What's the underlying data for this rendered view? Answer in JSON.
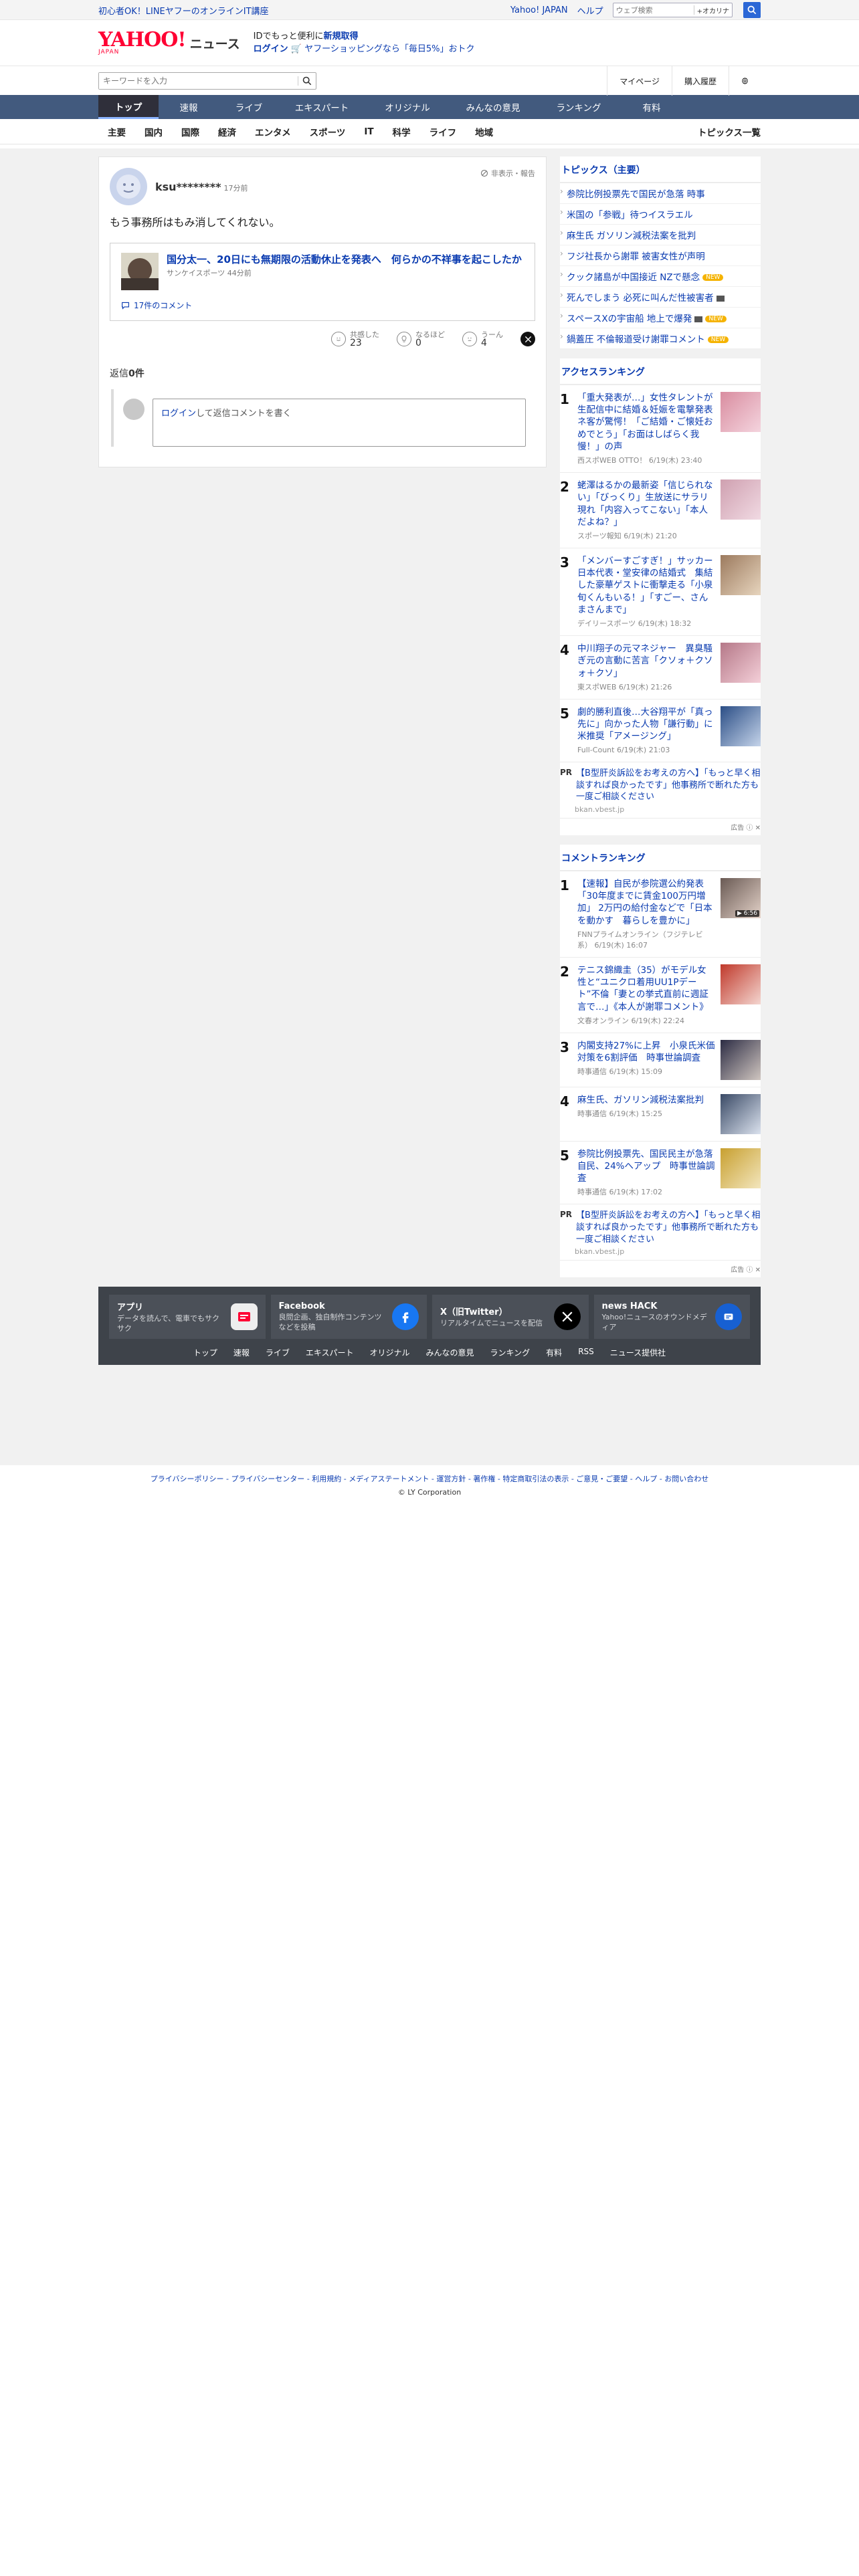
{
  "promo": {
    "text": "初心者OK！LINEヤフーのオンラインIT講座",
    "yahoo_japan": "Yahoo! JAPAN",
    "help": "ヘルプ",
    "web_search_placeholder": "ウェブ検索",
    "kakaku": "+オカリナ"
  },
  "header": {
    "logo_main": "YAHOO!",
    "logo_sub": "JAPAN",
    "logo_news": "ニュース",
    "msg_prefix": "IDでもっと便利に",
    "msg_signup": "新規取得",
    "login": "ログイン",
    "shopping_msg": "ヤフーショッピングなら「毎日5%」おトク"
  },
  "search": {
    "placeholder": "キーワードを入力",
    "mypage": "マイページ",
    "history": "購入履歴"
  },
  "navtabs": [
    "トップ",
    "速報",
    "ライブ",
    "エキスパート",
    "オリジナル",
    "みんなの意見",
    "ランキング",
    "有料"
  ],
  "categories": [
    "主要",
    "国内",
    "国際",
    "経済",
    "エンタメ",
    "スポーツ",
    "IT",
    "科学",
    "ライフ",
    "地域"
  ],
  "categories_all": "トピックス一覧",
  "comment": {
    "user": "ksu********",
    "time": "17分前",
    "flag": "非表示・報告",
    "body": "もう事務所はもみ消してくれない。",
    "article_title": "国分太一、20日にも無期限の活動休止を発表へ　何らかの不祥事を起こしたか",
    "article_source": "サンケイスポーツ 44分前",
    "article_comments": "17件のコメント",
    "react_agree_label": "共感した",
    "react_agree_count": "23",
    "react_think_label": "なるほど",
    "react_think_count": "0",
    "react_hmm_label": "うーん",
    "react_hmm_count": "4",
    "reply_label": "返信",
    "reply_count": "0件",
    "reply_login": "ログイン",
    "reply_prompt": "して返信コメントを書く"
  },
  "topics": {
    "heading": "トピックス（主要）",
    "items": [
      {
        "text": "参院比例投票先で国民が急落 時事",
        "badge": ""
      },
      {
        "text": "米国の「参戦」待つイスラエル",
        "badge": ""
      },
      {
        "text": "麻生氏 ガソリン減税法案を批判",
        "badge": ""
      },
      {
        "text": "フジ社長から謝罪 被害女性が声明",
        "badge": ""
      },
      {
        "text": "クック諸島が中国接近 NZで懸念",
        "badge": "NEW"
      },
      {
        "text": "死んでしまう 必死に叫んだ性被害者",
        "badge": "video"
      },
      {
        "text": "スペースXの宇宙船 地上で爆発",
        "badge": "NEW"
      },
      {
        "text": "鍋蓋圧 不倫報道受け謝罪コメント",
        "badge": "NEW"
      }
    ]
  },
  "access_ranking": {
    "heading": "アクセスランキング",
    "items": [
      {
        "no": "1",
        "title": "「重大発表が…」女性タレントが生配信中に結婚＆妊娠を電撃発表 ネ客が驚愕！「ご結婚・ご懐妊おめでとう」「お面はしばらく我慢！」の声",
        "meta": "西スポWEB OTTO！ 6/19(木) 23:40"
      },
      {
        "no": "2",
        "title": "蛯澤はるかの最新姿「信じられない」「びっくり」生放送にサラリ現れ「内容入ってこない」「本人だよね？」",
        "meta": "スポーツ報知 6/19(木) 21:20"
      },
      {
        "no": "3",
        "title": "「メンバーすごすぎ！」サッカー日本代表・堂安律の結婚式　集結した豪華ゲストに衝撃走る「小泉旬くんもいる！」「すごー、さんまさんまで」",
        "meta": "デイリースポーツ 6/19(木) 18:32"
      },
      {
        "no": "4",
        "title": "中川翔子の元マネジャー　異臭騒ぎ元の言動に苦言「クソォ＋クソォ＋クソ」",
        "meta": "東スポWEB 6/19(木) 21:26"
      },
      {
        "no": "5",
        "title": "劇的勝利直後…大谷翔平が「真っ先に」向かった人物「謙行動」に米推奨「アメージング」",
        "meta": "Full-Count 6/19(木) 21:03"
      }
    ],
    "pr_tag": "PR",
    "pr_text": "【B型肝炎訴訟をお考えの方へ】「もっと早く相談すれば良かったです」他事務所で断れた方も一度ご相談ください",
    "pr_src": "bkan.vbest.jp",
    "ad_label": "広告"
  },
  "comment_ranking": {
    "heading": "コメントランキング",
    "items": [
      {
        "no": "1",
        "title": "【速報】自民が参院選公約発表「30年度までに賃金100万円増加」 2万円の給付金などで「日本を動かす　暮らしを豊かに」",
        "meta": "FNNプライムオンライン（フジテレビ系） 6/19(木) 16:07",
        "play": "▶ 6:56"
      },
      {
        "no": "2",
        "title": "テニス錦織圭（35）がモデル女性と“ユニクロ着用UU1Pデート”不倫「妻との挙式直前に週証言で…」《本人が謝罪コメント》",
        "meta": "文春オンライン 6/19(木) 22:24",
        "play": ""
      },
      {
        "no": "3",
        "title": "内閣支持27%に上昇　小泉氏米価対策を6割評価　時事世論調査",
        "meta": "時事通信 6/19(木) 15:09",
        "play": ""
      },
      {
        "no": "4",
        "title": "麻生氏、ガソリン減税法案批判",
        "meta": "時事通信 6/19(木) 15:25",
        "play": ""
      },
      {
        "no": "5",
        "title": "参院比例投票先、国民民主が急落　自民、24%へアップ　時事世論調査",
        "meta": "時事通信 6/19(木) 17:02",
        "play": ""
      }
    ],
    "pr_tag": "PR",
    "pr_text": "【B型肝炎訴訟をお考えの方へ】「もっと早く相談すれば良かったです」他事務所で断れた方も一度ご相談ください",
    "pr_src": "bkan.vbest.jp",
    "ad_label": "広告"
  },
  "footer": {
    "cards": [
      {
        "title": "アプリ",
        "desc": "データを読んで、電車でもサクサク"
      },
      {
        "title": "Facebook",
        "desc": "良問企画、独自制作コンテンツなどを投稿"
      },
      {
        "title": "X（旧Twitter）",
        "desc": "リアルタイムでニュースを配信"
      },
      {
        "title": "news HACK",
        "desc": "Yahoo!ニュースのオウンドメディア"
      }
    ],
    "links": [
      "トップ",
      "速報",
      "ライブ",
      "エキスパート",
      "オリジナル",
      "みんなの意見",
      "ランキング",
      "有料",
      "RSS",
      "ニュース提供社"
    ],
    "legal": "プライバシーポリシー - プライバシーセンター - 利用規約 - メディアステートメント - 運営方針 - 著作権 - 特定商取引法の表示 - ご意見・ご要望 - ヘルプ - お問い合わせ",
    "copyright": "© LY Corporation"
  },
  "colors": {
    "brand_red": "#ff0033",
    "nav_blue": "#425a7e",
    "link_blue": "#0a3bb0",
    "footer_bg": "#3e434a"
  }
}
